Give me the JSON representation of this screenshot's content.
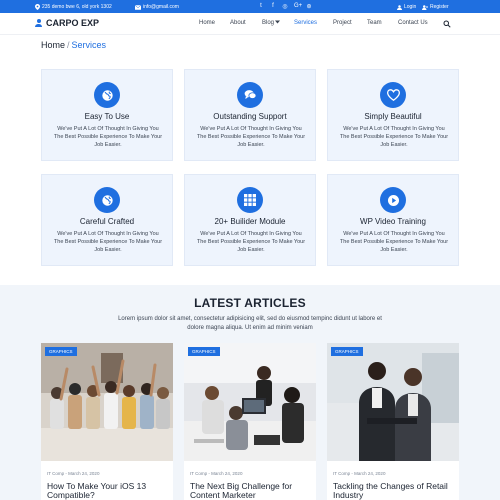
{
  "topbar": {
    "address": "235 demo bwe 6, old york 1302",
    "email": "info@gmail.com",
    "social": [
      {
        "icon": "twitter-icon",
        "glyph": "t"
      },
      {
        "icon": "facebook-icon",
        "glyph": "f"
      },
      {
        "icon": "instagram-icon",
        "glyph": "◎"
      },
      {
        "icon": "google-plus-icon",
        "glyph": "G+"
      },
      {
        "icon": "dribbble-icon",
        "glyph": "⊛"
      }
    ],
    "login": "Login",
    "register": "Register"
  },
  "nav": {
    "brand": "CARPO EXP",
    "items": {
      "home": "Home",
      "about": "About",
      "blog": "Blog",
      "services": "Services",
      "project": "Project",
      "team": "Team",
      "contact": "Contact Us"
    },
    "active": "Services",
    "accent": "#1f6fe0"
  },
  "breadcrumb": {
    "home": "Home",
    "separator": "/",
    "current": "Services"
  },
  "services": [
    {
      "icon": "globe-icon",
      "title": "Easy To Use",
      "desc": "We've Put A Lot Of Thought In Giving You The Best Possible Experience To Make Your Job Easier."
    },
    {
      "icon": "chat-icon",
      "title": "Outstanding Support",
      "desc": "We've Put A Lot Of Thought In Giving You The Best Possible Experience To Make Your Job Easier."
    },
    {
      "icon": "heart-icon",
      "title": "Simply Beautiful",
      "desc": "We've Put A Lot Of Thought In Giving You The Best Possible Experience To Make Your Job Easier."
    },
    {
      "icon": "globe-icon",
      "title": "Careful Crafted",
      "desc": "We've Put A Lot Of Thought In Giving You The Best Possible Experience To Make Your Job Easier."
    },
    {
      "icon": "grid-icon",
      "title": "20+ Builider Module",
      "desc": "We've Put A Lot Of Thought In Giving You The Best Possible Experience To Make Your Job Easier."
    },
    {
      "icon": "play-icon",
      "title": "WP Video Training",
      "desc": "We've Put A Lot Of Thought In Giving You The Best Possible Experience To Make Your Job Easier."
    }
  ],
  "articles": {
    "heading": "LATEST ARTICLES",
    "subheading": "Lorem ipsum dolor sit amet, consectetur adipisicing elit, sed do eiusmod tempinc didunt ut labore et dolore magna aliqua. Ut enim ad minim veniam",
    "items": [
      {
        "badge": "GRAPHICS",
        "author": "IT Comp",
        "date": "March 24, 2020",
        "title": "How To Make Your iOS 13 Compatible?"
      },
      {
        "badge": "GRAPHICS",
        "author": "IT Comp",
        "date": "March 24, 2020",
        "title": "The Next Big Challenge for Content Marketer"
      },
      {
        "badge": "GRAPHICS",
        "author": "IT Comp",
        "date": "March 24, 2020",
        "title": "Tackling the Changes of Retail Industry"
      }
    ]
  }
}
